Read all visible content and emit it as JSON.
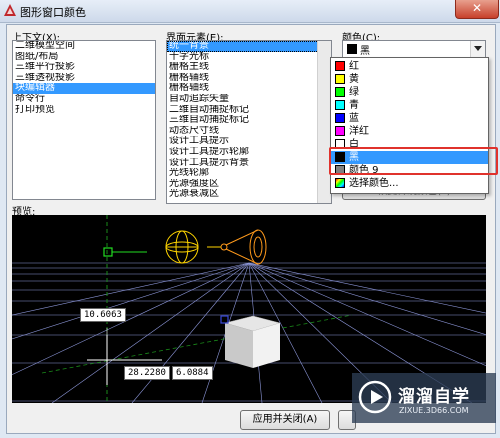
{
  "window": {
    "title": "图形窗口颜色",
    "close_glyph": "✕"
  },
  "context": {
    "label": "上下文(X):",
    "items": [
      "二维模型空间",
      "图纸/布局",
      "三维平行投影",
      "三维透视投影",
      "块编辑器",
      "命令行",
      "打印预览"
    ],
    "selected_index": 4
  },
  "interface": {
    "label": "界面元素(E):",
    "items": [
      "统一背景",
      "十字光标",
      "栅格主线",
      "栅格辅线",
      "栅格轴线",
      "自动追踪矢量",
      "二维自动捕捉标记",
      "三维自动捕捉标记",
      "动态尺寸线",
      "设计工具提示",
      "设计工具提示轮廓",
      "设计工具提示背景",
      "光线轮廓",
      "光源强度区",
      "光源衰减区"
    ],
    "selected_index": 0
  },
  "color": {
    "label": "颜色(C):",
    "current": {
      "name": "黑",
      "hex": "#000000"
    },
    "options": [
      {
        "name": "红",
        "hex": "#ff0000"
      },
      {
        "name": "黄",
        "hex": "#ffff00"
      },
      {
        "name": "绿",
        "hex": "#00ff00"
      },
      {
        "name": "青",
        "hex": "#00ffff"
      },
      {
        "name": "蓝",
        "hex": "#0000ff"
      },
      {
        "name": "洋红",
        "hex": "#ff00ff"
      },
      {
        "name": "白",
        "hex": "#ffffff"
      },
      {
        "name": "黑",
        "hex": "#000000"
      },
      {
        "name": "颜色 9",
        "hex": "#808080"
      },
      {
        "name": "选择颜色...",
        "hex": "multi"
      }
    ],
    "selected_index": 7,
    "restore_button_partial": "恢复传统颜色(L)"
  },
  "preview": {
    "label": "预览:",
    "measure_1": "10.6063",
    "measure_2": "28.2280",
    "measure_3": "6.0884"
  },
  "buttons": {
    "apply_close": "应用并关闭(A)"
  },
  "watermark": {
    "brand": "溜溜自学",
    "url": "ZIXUE.3D66.COM"
  }
}
